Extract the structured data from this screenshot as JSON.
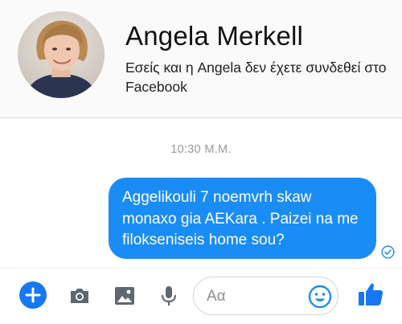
{
  "contact": {
    "name": "Angela Merkell",
    "status": "Εσείς και η Angela δεν έχετε συνδεθεί στο Facebook"
  },
  "conversation": {
    "timestamp": "10:30 Μ.Μ.",
    "messages": [
      {
        "sender": "me",
        "text": "Aggelikouli 7 noemvrh skaw monaxo gia AEKara . Paizei na me filokseniseis home sou?"
      }
    ]
  },
  "composer": {
    "placeholder": "Αα"
  },
  "icons": {
    "add": "plus-icon",
    "camera": "camera-icon",
    "gallery": "image-icon",
    "voice": "microphone-icon",
    "emoji": "smiley-icon",
    "like": "thumbs-up-icon",
    "seen": "check-circle-icon"
  },
  "colors": {
    "accent": "#1877f2",
    "bubble": "#1a8cf5",
    "icon_gray": "#606770"
  }
}
